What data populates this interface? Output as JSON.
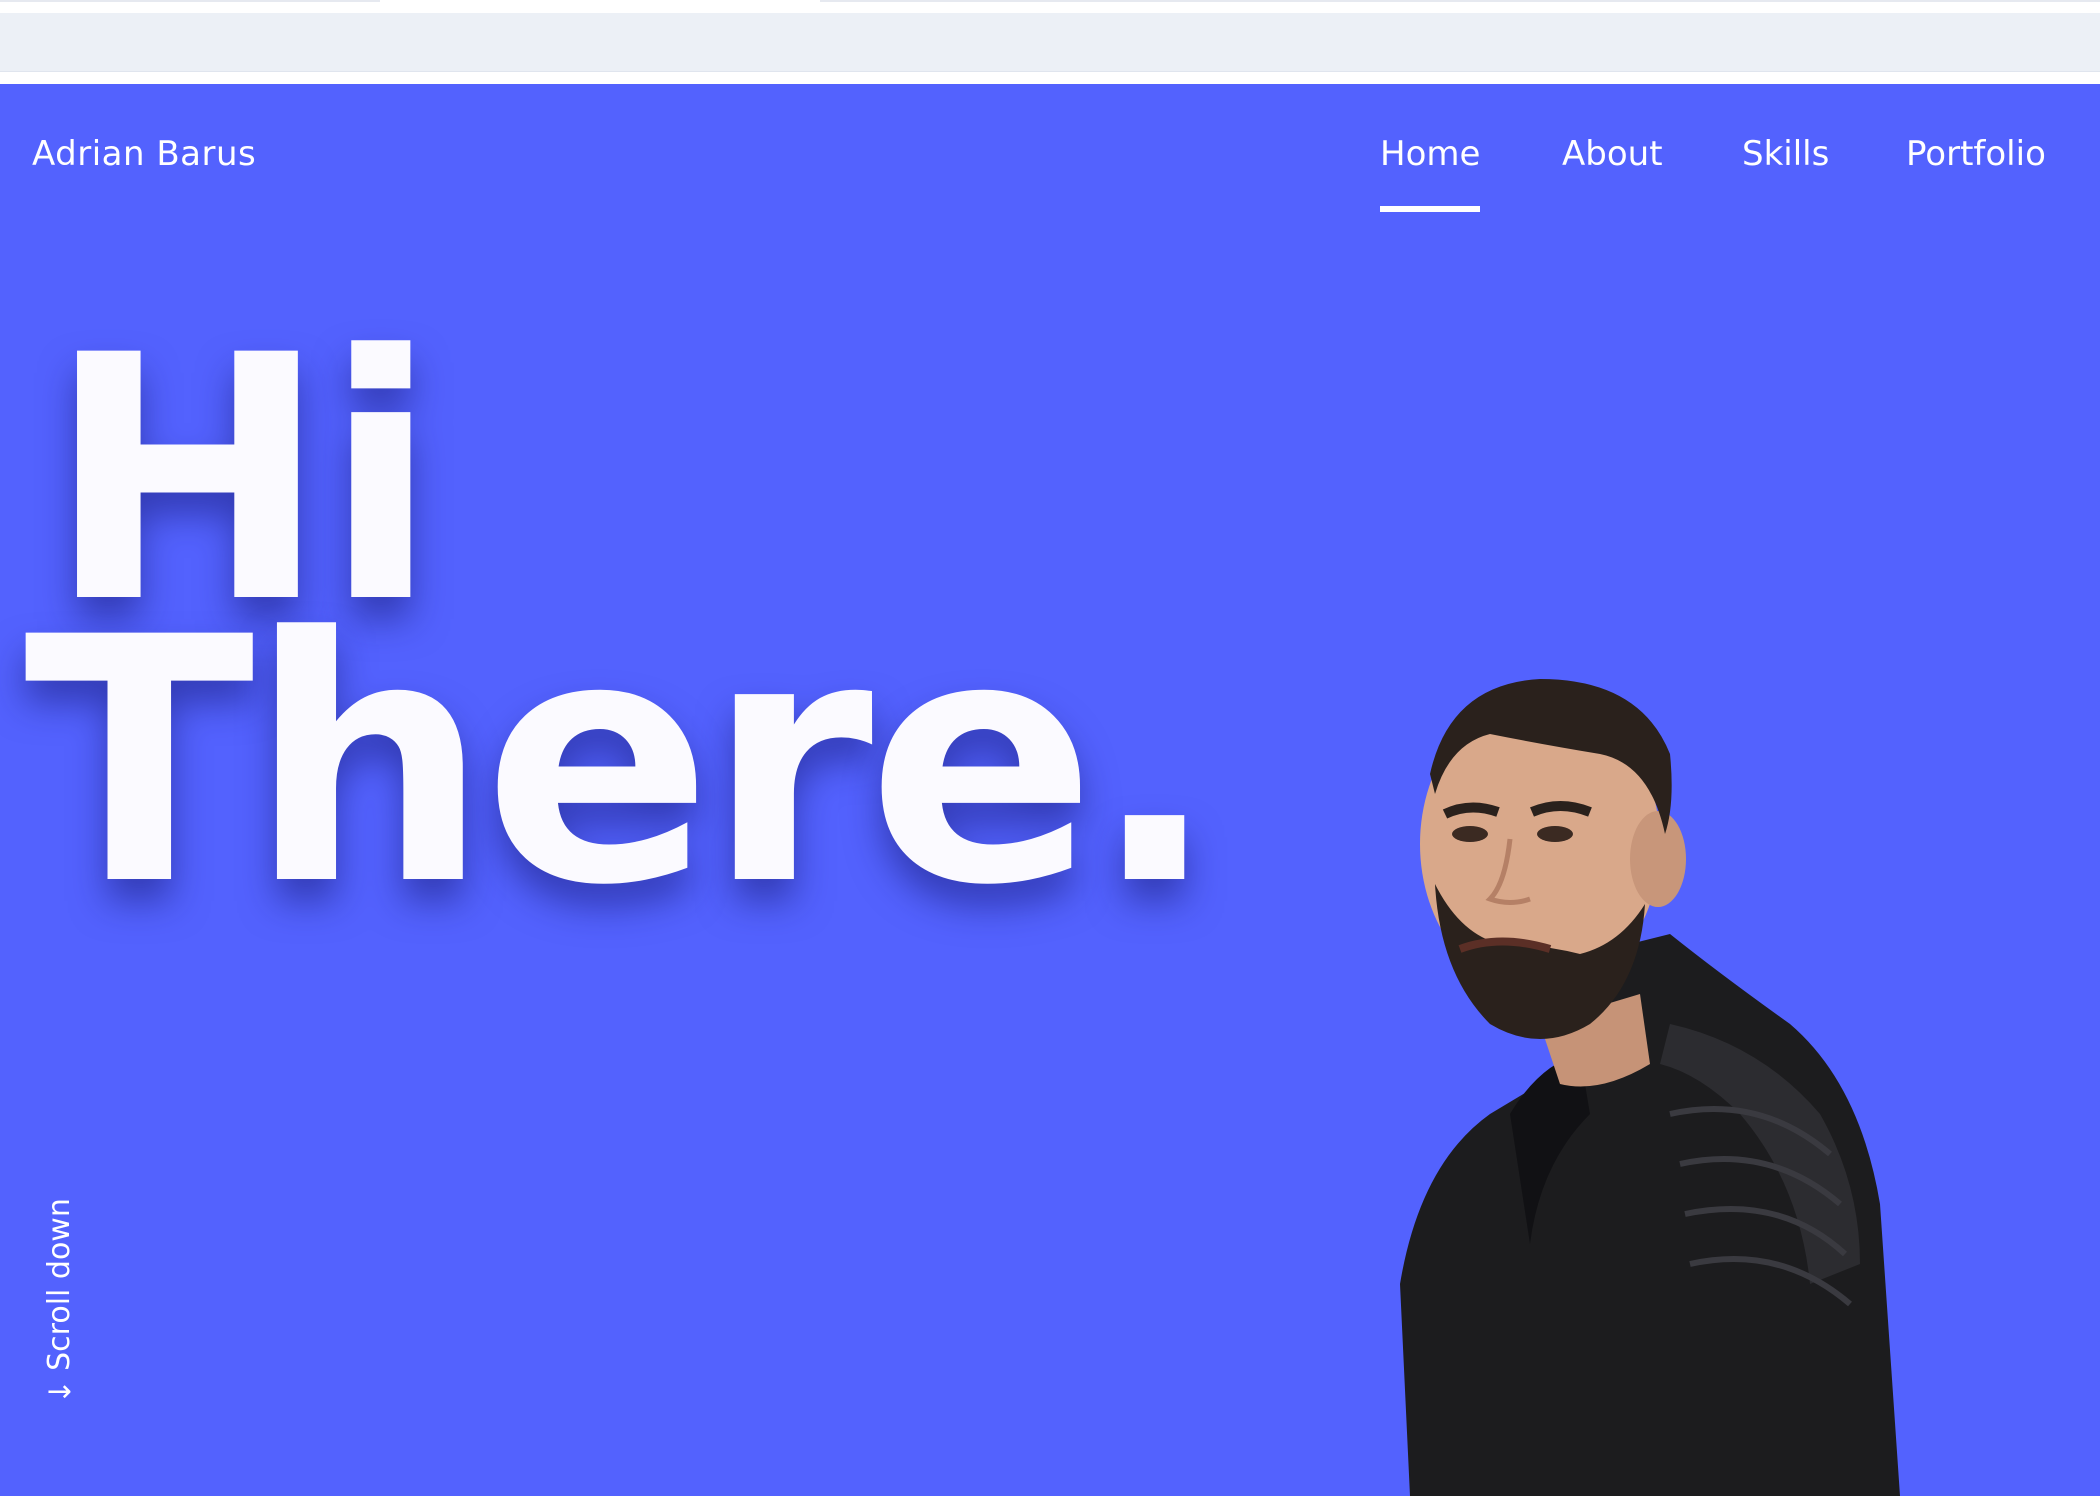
{
  "colors": {
    "hero_background": "#5362fe",
    "headline": "#fbfaff",
    "nav_text": "#ffffff",
    "browser_bar": "#ecf0f6"
  },
  "header": {
    "brand": "Adrian Barus",
    "nav": [
      {
        "label": "Home",
        "active": true
      },
      {
        "label": "About",
        "active": false
      },
      {
        "label": "Skills",
        "active": false
      },
      {
        "label": "Portfolio",
        "active": false
      }
    ]
  },
  "hero": {
    "headline_line1": "Hi",
    "headline_line2": "There.",
    "scroll_label": "Scroll down",
    "scroll_icon": "arrow-down-icon"
  },
  "portrait": {
    "icon": "person-photo"
  }
}
